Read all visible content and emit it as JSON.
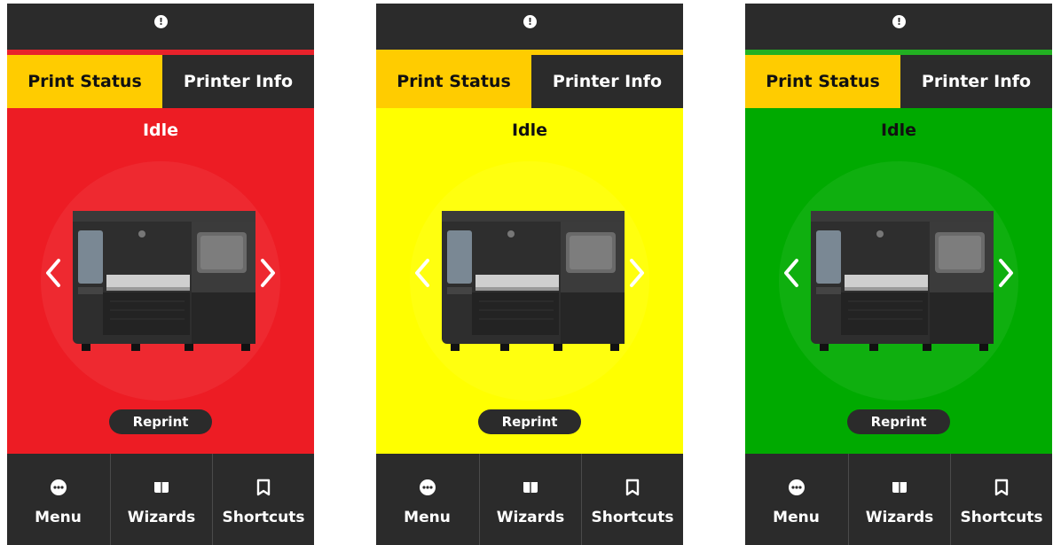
{
  "screens": [
    {
      "variant": "red",
      "stripe_color": "#e8222b",
      "status_bg": "#ed1c24",
      "status_text_color": "#ffffff",
      "tabs": [
        {
          "label": "Print Status"
        },
        {
          "label": "Printer Info"
        }
      ],
      "status_title": "Idle",
      "reprint_label": "Reprint",
      "nav": [
        {
          "label": "Menu",
          "icon": "menu-dots-icon"
        },
        {
          "label": "Wizards",
          "icon": "book-icon"
        },
        {
          "label": "Shortcuts",
          "icon": "bookmark-icon"
        }
      ]
    },
    {
      "variant": "yellow",
      "stripe_color": "#ffcc00",
      "status_bg": "#ffff00",
      "status_text_color": "#111111",
      "tabs": [
        {
          "label": "Print Status"
        },
        {
          "label": "Printer Info"
        }
      ],
      "status_title": "Idle",
      "reprint_label": "Reprint",
      "nav": [
        {
          "label": "Menu",
          "icon": "menu-dots-icon"
        },
        {
          "label": "Wizards",
          "icon": "book-icon"
        },
        {
          "label": "Shortcuts",
          "icon": "bookmark-icon"
        }
      ]
    },
    {
      "variant": "green",
      "stripe_color": "#22b022",
      "status_bg": "#00aa00",
      "status_text_color": "#111111",
      "tabs": [
        {
          "label": "Print Status"
        },
        {
          "label": "Printer Info"
        }
      ],
      "status_title": "Idle",
      "reprint_label": "Reprint",
      "nav": [
        {
          "label": "Menu",
          "icon": "menu-dots-icon"
        },
        {
          "label": "Wizards",
          "icon": "book-icon"
        },
        {
          "label": "Shortcuts",
          "icon": "bookmark-icon"
        }
      ]
    }
  ],
  "alert_icon_glyph": "!",
  "colors": {
    "tab_active": "#ffcc00",
    "dark": "#2b2b2b"
  }
}
